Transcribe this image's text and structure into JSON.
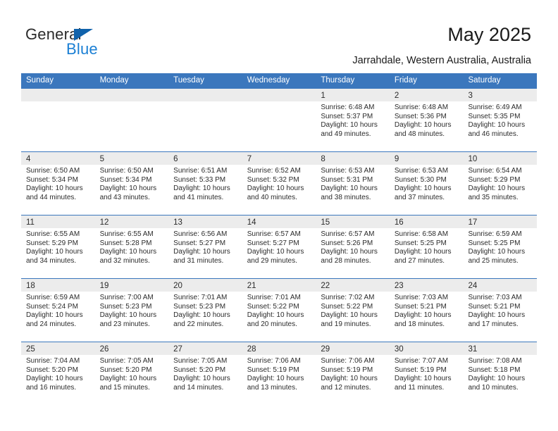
{
  "brand": {
    "name_part1": "General",
    "name_part2": "Blue",
    "accent_color": "#1a7fd4",
    "triangle_color": "#1062ab"
  },
  "header": {
    "title": "May 2025",
    "subtitle": "Jarrahdale, Western Australia, Australia"
  },
  "theme": {
    "header_blue": "#3b77bd",
    "day_strip_gray": "#ececec"
  },
  "weekdays": [
    "Sunday",
    "Monday",
    "Tuesday",
    "Wednesday",
    "Thursday",
    "Friday",
    "Saturday"
  ],
  "weeks": [
    [
      {
        "day": "",
        "sunrise": "",
        "sunset": "",
        "daylight1": "",
        "daylight2": ""
      },
      {
        "day": "",
        "sunrise": "",
        "sunset": "",
        "daylight1": "",
        "daylight2": ""
      },
      {
        "day": "",
        "sunrise": "",
        "sunset": "",
        "daylight1": "",
        "daylight2": ""
      },
      {
        "day": "",
        "sunrise": "",
        "sunset": "",
        "daylight1": "",
        "daylight2": ""
      },
      {
        "day": "1",
        "sunrise": "Sunrise: 6:48 AM",
        "sunset": "Sunset: 5:37 PM",
        "daylight1": "Daylight: 10 hours",
        "daylight2": "and 49 minutes."
      },
      {
        "day": "2",
        "sunrise": "Sunrise: 6:48 AM",
        "sunset": "Sunset: 5:36 PM",
        "daylight1": "Daylight: 10 hours",
        "daylight2": "and 48 minutes."
      },
      {
        "day": "3",
        "sunrise": "Sunrise: 6:49 AM",
        "sunset": "Sunset: 5:35 PM",
        "daylight1": "Daylight: 10 hours",
        "daylight2": "and 46 minutes."
      }
    ],
    [
      {
        "day": "4",
        "sunrise": "Sunrise: 6:50 AM",
        "sunset": "Sunset: 5:34 PM",
        "daylight1": "Daylight: 10 hours",
        "daylight2": "and 44 minutes."
      },
      {
        "day": "5",
        "sunrise": "Sunrise: 6:50 AM",
        "sunset": "Sunset: 5:34 PM",
        "daylight1": "Daylight: 10 hours",
        "daylight2": "and 43 minutes."
      },
      {
        "day": "6",
        "sunrise": "Sunrise: 6:51 AM",
        "sunset": "Sunset: 5:33 PM",
        "daylight1": "Daylight: 10 hours",
        "daylight2": "and 41 minutes."
      },
      {
        "day": "7",
        "sunrise": "Sunrise: 6:52 AM",
        "sunset": "Sunset: 5:32 PM",
        "daylight1": "Daylight: 10 hours",
        "daylight2": "and 40 minutes."
      },
      {
        "day": "8",
        "sunrise": "Sunrise: 6:53 AM",
        "sunset": "Sunset: 5:31 PM",
        "daylight1": "Daylight: 10 hours",
        "daylight2": "and 38 minutes."
      },
      {
        "day": "9",
        "sunrise": "Sunrise: 6:53 AM",
        "sunset": "Sunset: 5:30 PM",
        "daylight1": "Daylight: 10 hours",
        "daylight2": "and 37 minutes."
      },
      {
        "day": "10",
        "sunrise": "Sunrise: 6:54 AM",
        "sunset": "Sunset: 5:29 PM",
        "daylight1": "Daylight: 10 hours",
        "daylight2": "and 35 minutes."
      }
    ],
    [
      {
        "day": "11",
        "sunrise": "Sunrise: 6:55 AM",
        "sunset": "Sunset: 5:29 PM",
        "daylight1": "Daylight: 10 hours",
        "daylight2": "and 34 minutes."
      },
      {
        "day": "12",
        "sunrise": "Sunrise: 6:55 AM",
        "sunset": "Sunset: 5:28 PM",
        "daylight1": "Daylight: 10 hours",
        "daylight2": "and 32 minutes."
      },
      {
        "day": "13",
        "sunrise": "Sunrise: 6:56 AM",
        "sunset": "Sunset: 5:27 PM",
        "daylight1": "Daylight: 10 hours",
        "daylight2": "and 31 minutes."
      },
      {
        "day": "14",
        "sunrise": "Sunrise: 6:57 AM",
        "sunset": "Sunset: 5:27 PM",
        "daylight1": "Daylight: 10 hours",
        "daylight2": "and 29 minutes."
      },
      {
        "day": "15",
        "sunrise": "Sunrise: 6:57 AM",
        "sunset": "Sunset: 5:26 PM",
        "daylight1": "Daylight: 10 hours",
        "daylight2": "and 28 minutes."
      },
      {
        "day": "16",
        "sunrise": "Sunrise: 6:58 AM",
        "sunset": "Sunset: 5:25 PM",
        "daylight1": "Daylight: 10 hours",
        "daylight2": "and 27 minutes."
      },
      {
        "day": "17",
        "sunrise": "Sunrise: 6:59 AM",
        "sunset": "Sunset: 5:25 PM",
        "daylight1": "Daylight: 10 hours",
        "daylight2": "and 25 minutes."
      }
    ],
    [
      {
        "day": "18",
        "sunrise": "Sunrise: 6:59 AM",
        "sunset": "Sunset: 5:24 PM",
        "daylight1": "Daylight: 10 hours",
        "daylight2": "and 24 minutes."
      },
      {
        "day": "19",
        "sunrise": "Sunrise: 7:00 AM",
        "sunset": "Sunset: 5:23 PM",
        "daylight1": "Daylight: 10 hours",
        "daylight2": "and 23 minutes."
      },
      {
        "day": "20",
        "sunrise": "Sunrise: 7:01 AM",
        "sunset": "Sunset: 5:23 PM",
        "daylight1": "Daylight: 10 hours",
        "daylight2": "and 22 minutes."
      },
      {
        "day": "21",
        "sunrise": "Sunrise: 7:01 AM",
        "sunset": "Sunset: 5:22 PM",
        "daylight1": "Daylight: 10 hours",
        "daylight2": "and 20 minutes."
      },
      {
        "day": "22",
        "sunrise": "Sunrise: 7:02 AM",
        "sunset": "Sunset: 5:22 PM",
        "daylight1": "Daylight: 10 hours",
        "daylight2": "and 19 minutes."
      },
      {
        "day": "23",
        "sunrise": "Sunrise: 7:03 AM",
        "sunset": "Sunset: 5:21 PM",
        "daylight1": "Daylight: 10 hours",
        "daylight2": "and 18 minutes."
      },
      {
        "day": "24",
        "sunrise": "Sunrise: 7:03 AM",
        "sunset": "Sunset: 5:21 PM",
        "daylight1": "Daylight: 10 hours",
        "daylight2": "and 17 minutes."
      }
    ],
    [
      {
        "day": "25",
        "sunrise": "Sunrise: 7:04 AM",
        "sunset": "Sunset: 5:20 PM",
        "daylight1": "Daylight: 10 hours",
        "daylight2": "and 16 minutes."
      },
      {
        "day": "26",
        "sunrise": "Sunrise: 7:05 AM",
        "sunset": "Sunset: 5:20 PM",
        "daylight1": "Daylight: 10 hours",
        "daylight2": "and 15 minutes."
      },
      {
        "day": "27",
        "sunrise": "Sunrise: 7:05 AM",
        "sunset": "Sunset: 5:20 PM",
        "daylight1": "Daylight: 10 hours",
        "daylight2": "and 14 minutes."
      },
      {
        "day": "28",
        "sunrise": "Sunrise: 7:06 AM",
        "sunset": "Sunset: 5:19 PM",
        "daylight1": "Daylight: 10 hours",
        "daylight2": "and 13 minutes."
      },
      {
        "day": "29",
        "sunrise": "Sunrise: 7:06 AM",
        "sunset": "Sunset: 5:19 PM",
        "daylight1": "Daylight: 10 hours",
        "daylight2": "and 12 minutes."
      },
      {
        "day": "30",
        "sunrise": "Sunrise: 7:07 AM",
        "sunset": "Sunset: 5:19 PM",
        "daylight1": "Daylight: 10 hours",
        "daylight2": "and 11 minutes."
      },
      {
        "day": "31",
        "sunrise": "Sunrise: 7:08 AM",
        "sunset": "Sunset: 5:18 PM",
        "daylight1": "Daylight: 10 hours",
        "daylight2": "and 10 minutes."
      }
    ]
  ]
}
